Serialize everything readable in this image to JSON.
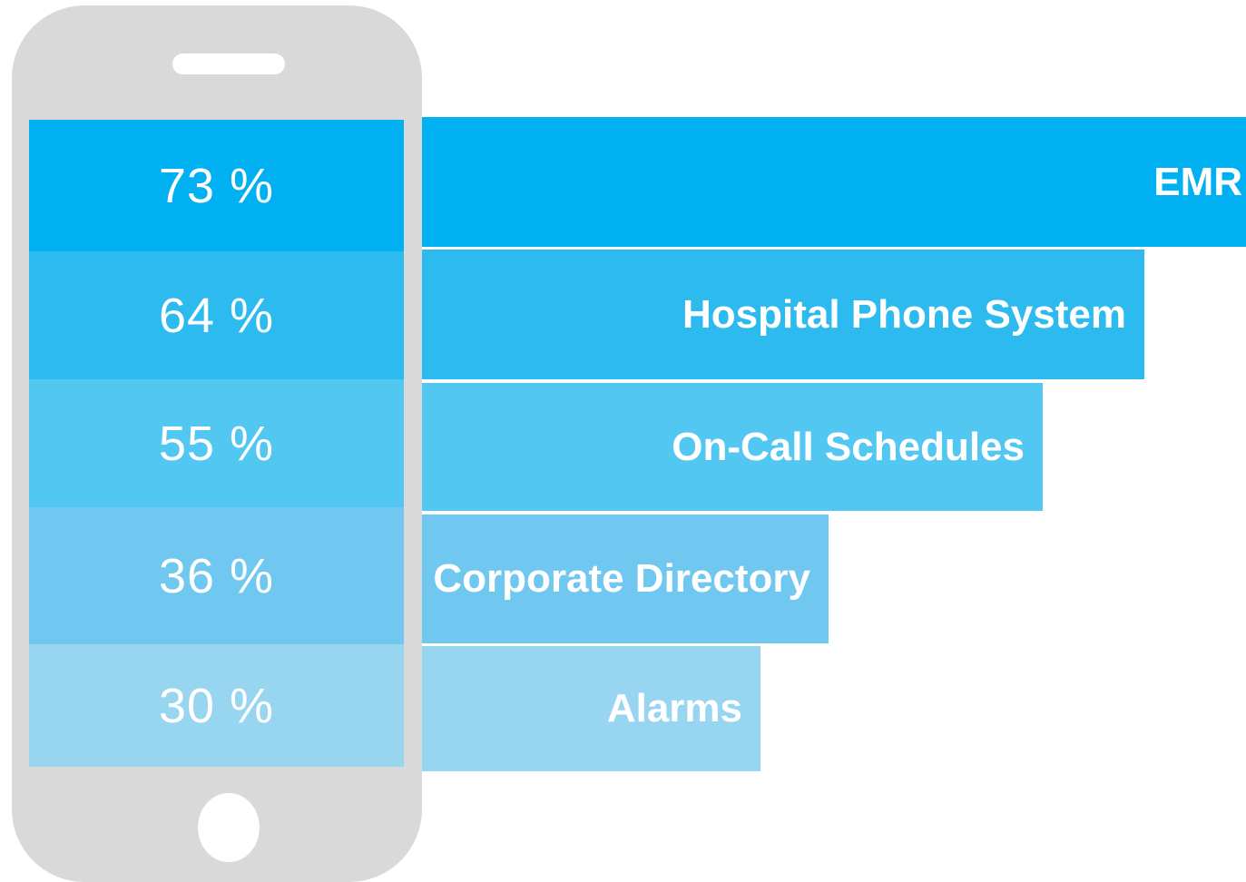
{
  "chart_data": {
    "type": "bar",
    "orientation": "horizontal",
    "title": "",
    "xlabel": "",
    "ylabel": "",
    "xlim": [
      0,
      73
    ],
    "categories": [
      "EMR",
      "Hospital Phone System",
      "On-Call Schedules",
      "Corporate Directory",
      "Alarms"
    ],
    "values": [
      73,
      64,
      55,
      36,
      30
    ],
    "value_labels": [
      "73 %",
      "64 %",
      "55 %",
      "36 %",
      "30 %"
    ],
    "colors": [
      "#00b0f0",
      "#2dbbef",
      "#51c7f1",
      "#70c8f0",
      "#98d5f1"
    ],
    "grid": false,
    "legend": "none"
  },
  "device": {
    "type": "smartphone-outline",
    "body_color": "#d9d9d9"
  }
}
